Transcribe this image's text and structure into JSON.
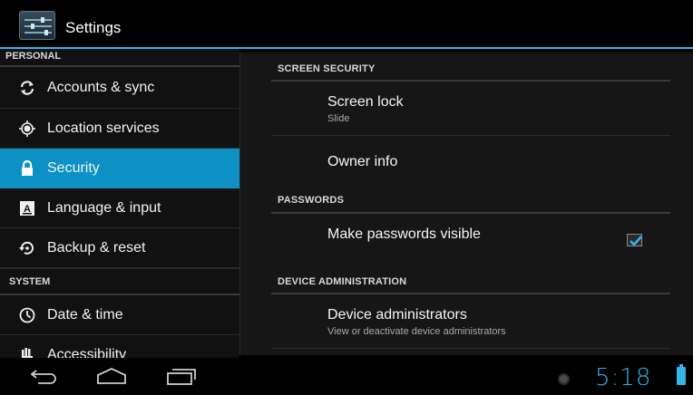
{
  "app": {
    "title": "Settings",
    "icon": "settings-sliders-icon"
  },
  "sidebar": {
    "personal_header": "PERSONAL",
    "system_header": "SYSTEM",
    "items": [
      {
        "label": "Accounts & sync",
        "icon": "sync-icon",
        "active": false
      },
      {
        "label": "Location services",
        "icon": "location-icon",
        "active": false
      },
      {
        "label": "Security",
        "icon": "lock-icon",
        "active": true
      },
      {
        "label": "Language & input",
        "icon": "keyboard-a-icon",
        "active": false
      },
      {
        "label": "Backup & reset",
        "icon": "backup-icon",
        "active": false
      }
    ],
    "system_items": [
      {
        "label": "Date & time",
        "icon": "clock-icon"
      },
      {
        "label": "Accessibility",
        "icon": "hand-icon"
      }
    ]
  },
  "main": {
    "sections": [
      {
        "header": "SCREEN SECURITY",
        "prefs": [
          {
            "title": "Screen lock",
            "summary": "Slide"
          },
          {
            "title": "Owner info",
            "summary": ""
          }
        ]
      },
      {
        "header": "PASSWORDS",
        "prefs": [
          {
            "title": "Make passwords visible",
            "summary": "",
            "checked": true
          }
        ]
      },
      {
        "header": "DEVICE ADMINISTRATION",
        "prefs": [
          {
            "title": "Device administrators",
            "summary": "View or deactivate device administrators"
          }
        ]
      }
    ]
  },
  "status_bar": {
    "time": "5:18",
    "accent": "#33b5e5",
    "battery_icon": "battery-icon",
    "notification_icon": "notification-dot-icon"
  },
  "navigation": {
    "back_icon": "back-icon",
    "home_icon": "home-icon",
    "recents_icon": "recent-apps-icon"
  },
  "colors": {
    "accent": "#33b5e5",
    "selected": "#0d91c4"
  }
}
